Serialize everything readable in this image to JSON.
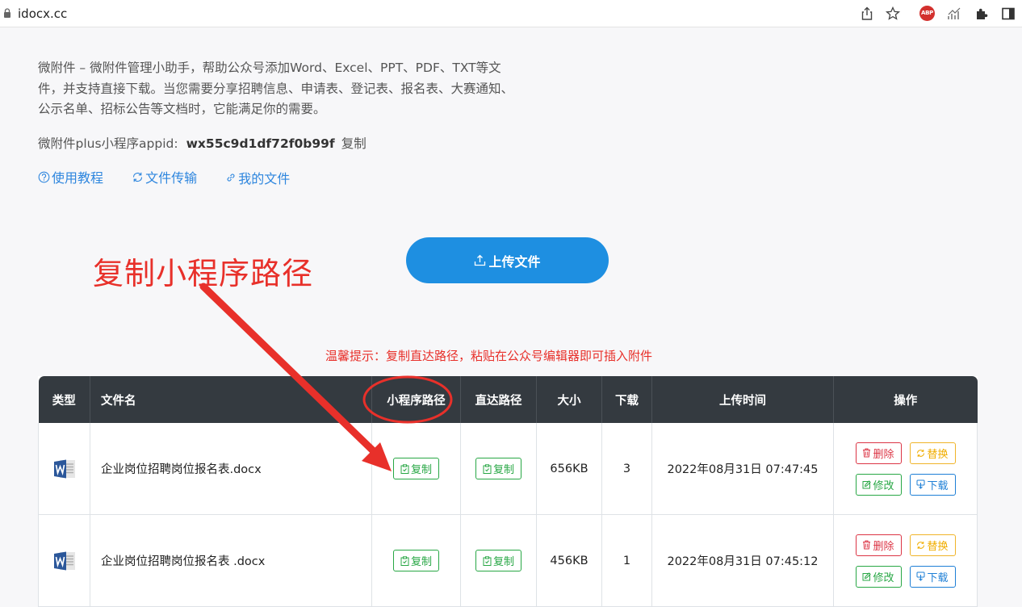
{
  "browser": {
    "url": "idocx.cc"
  },
  "intro": {
    "paragraph": "微附件 – 微附件管理小助手，帮助公众号添加Word、Excel、PPT、PDF、TXT等文件，并支持直接下载。当您需要分享招聘信息、申请表、登记表、报名表、大赛通知、公示名单、招标公告等文档时，它能满足你的需要。",
    "appid_label": "微附件plus小程序appid:",
    "appid_value": "wx55c9d1df72f0b99f",
    "appid_copy": "复制"
  },
  "links": {
    "tutorial": "使用教程",
    "transfer": "文件传输",
    "my_files": "我的文件"
  },
  "upload": {
    "label": "上传文件"
  },
  "annotation": {
    "text": "复制小程序路径"
  },
  "tip": "温馨提示：复制直达路径，粘贴在公众号编辑器即可插入附件",
  "table": {
    "headers": {
      "type": "类型",
      "name": "文件名",
      "mini_path": "小程序路径",
      "direct_path": "直达路径",
      "size": "大小",
      "downloads": "下载",
      "upload_time": "上传时间",
      "actions": "操作"
    },
    "rows": [
      {
        "name": "企业岗位招聘岗位报名表.docx",
        "size": "656KB",
        "downloads": "3",
        "time": "2022年08月31日 07:47:45"
      },
      {
        "name": "企业岗位招聘岗位报名表 .docx",
        "size": "456KB",
        "downloads": "1",
        "time": "2022年08月31日 07:45:12"
      }
    ],
    "buttons": {
      "copy": "复制",
      "delete": "删除",
      "replace": "替换",
      "edit": "修改",
      "download": "下载"
    }
  },
  "colors": {
    "primary": "#1e8fe1",
    "annotation": "#e8302a",
    "header_bg": "#343a40",
    "success": "#28a745",
    "danger": "#dc3545",
    "warning": "#f0ad00",
    "info": "#1e7fd6"
  }
}
